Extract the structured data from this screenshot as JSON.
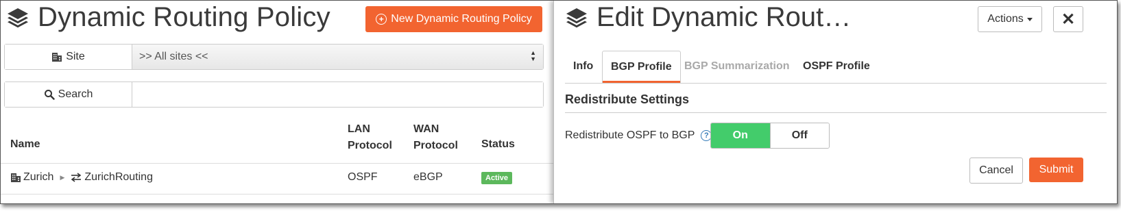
{
  "left_panel": {
    "title": "Dynamic Routing Policy",
    "new_button_label": "New Dynamic Routing Policy",
    "site_label": "Site",
    "site_select_value": ">> All sites <<",
    "search_label": "Search",
    "search_value": "",
    "table": {
      "headers": {
        "name": "Name",
        "lan_line1": "LAN",
        "lan_line2": "Protocol",
        "wan_line1": "WAN",
        "wan_line2": "Protocol",
        "status": "Status"
      },
      "rows": [
        {
          "site": "Zurich",
          "policy": "ZurichRouting",
          "lan": "OSPF",
          "wan": "eBGP",
          "status": "Active"
        }
      ]
    }
  },
  "right_panel": {
    "title": "Edit Dynamic Rout…",
    "actions_label": "Actions",
    "close_label": "✕",
    "tabs": [
      {
        "label": "Info",
        "state": "normal"
      },
      {
        "label": "BGP Profile",
        "state": "active"
      },
      {
        "label": "BGP Summarization",
        "state": "disabled"
      },
      {
        "label": "OSPF Profile",
        "state": "normal"
      }
    ],
    "section_title": "Redistribute Settings",
    "field_label": "Redistribute OSPF to BGP",
    "help_label": "?",
    "toggle": {
      "on_label": "On",
      "off_label": "Off",
      "selected": "On"
    },
    "cancel_label": "Cancel",
    "submit_label": "Submit"
  },
  "colors": {
    "accent_orange": "#f26430",
    "toggle_green": "#43cc6b",
    "badge_green": "#5cb85c",
    "help_blue": "#337ab7"
  },
  "icons": [
    "layers-icon",
    "plus-circle-icon",
    "building-icon",
    "search-icon",
    "chevron-right-icon",
    "exchange-arrows-icon",
    "caret-down-icon",
    "close-icon",
    "help-circle-icon"
  ]
}
